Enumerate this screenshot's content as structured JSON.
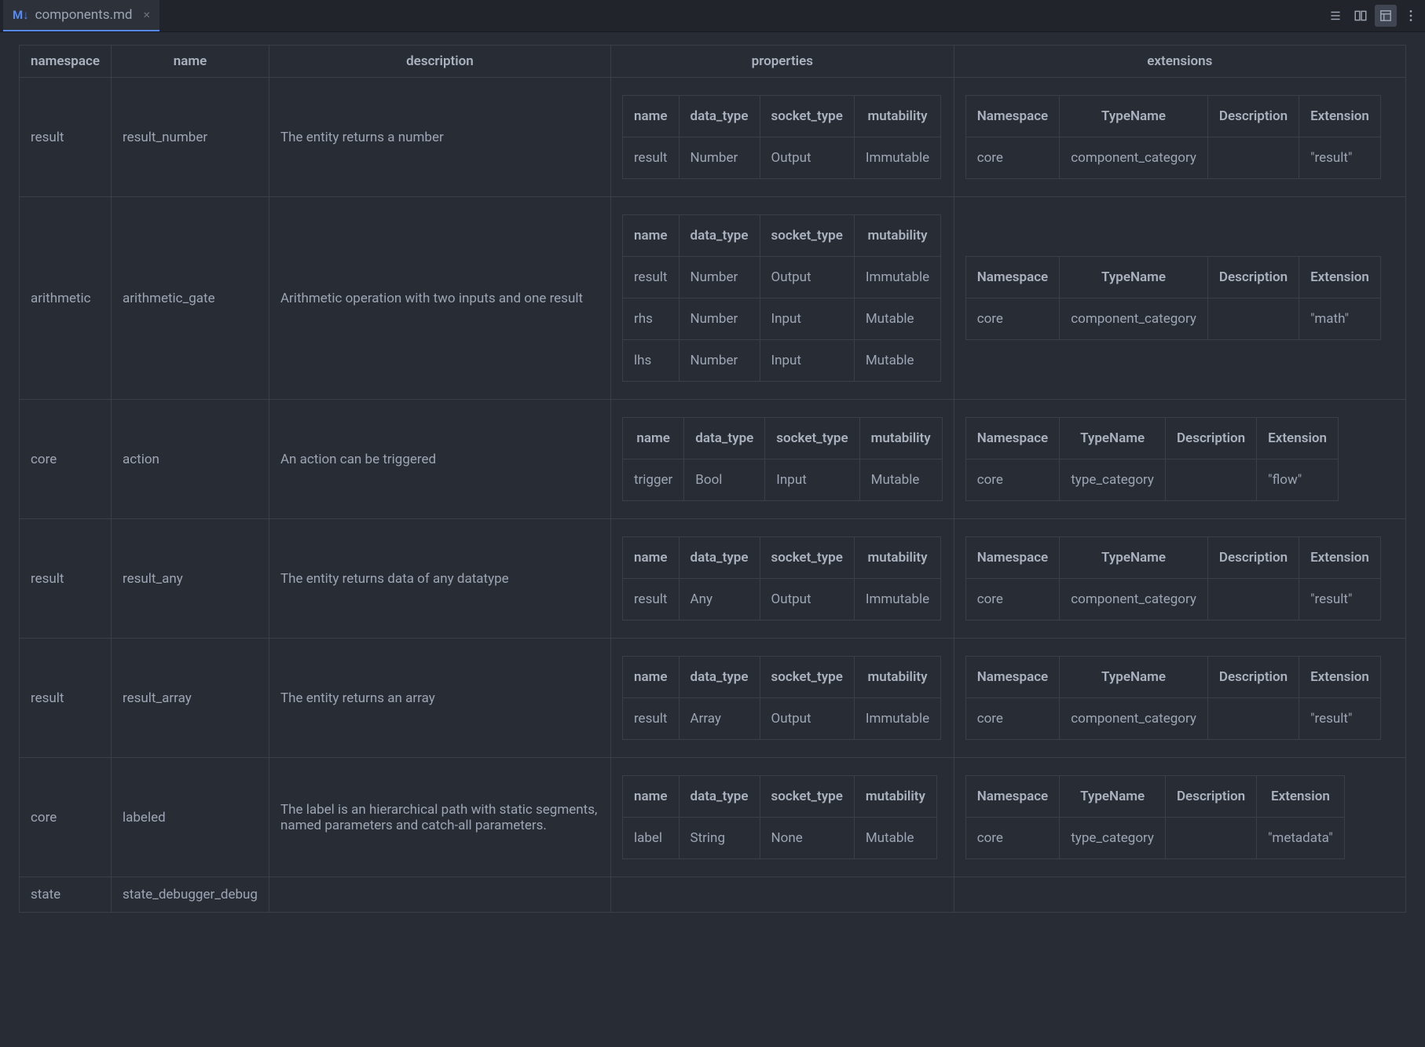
{
  "tab": {
    "icon_text": "M↓",
    "filename": "components.md"
  },
  "header_icons": [
    "outline-icon",
    "split-view-icon",
    "preview-icon",
    "more-icon"
  ],
  "columns": {
    "namespace": "namespace",
    "name": "name",
    "description": "description",
    "properties": "properties",
    "extensions": "extensions"
  },
  "prop_columns": {
    "name": "name",
    "data_type": "data_type",
    "socket_type": "socket_type",
    "mutability": "mutability"
  },
  "ext_columns": {
    "namespace": "Namespace",
    "typename": "TypeName",
    "description": "Description",
    "extension": "Extension"
  },
  "rows": [
    {
      "namespace": "result",
      "name": "result_number",
      "description": "The entity returns a number",
      "properties": [
        {
          "name": "result",
          "data_type": "Number",
          "socket_type": "Output",
          "mutability": "Immutable"
        }
      ],
      "extensions": [
        {
          "namespace": "core",
          "typename": "component_category",
          "description": "",
          "extension": "\"result\""
        }
      ]
    },
    {
      "namespace": "arithmetic",
      "name": "arithmetic_gate",
      "description": "Arithmetic operation with two inputs and one result",
      "properties": [
        {
          "name": "result",
          "data_type": "Number",
          "socket_type": "Output",
          "mutability": "Immutable"
        },
        {
          "name": "rhs",
          "data_type": "Number",
          "socket_type": "Input",
          "mutability": "Mutable"
        },
        {
          "name": "lhs",
          "data_type": "Number",
          "socket_type": "Input",
          "mutability": "Mutable"
        }
      ],
      "extensions": [
        {
          "namespace": "core",
          "typename": "component_category",
          "description": "",
          "extension": "\"math\""
        }
      ]
    },
    {
      "namespace": "core",
      "name": "action",
      "description": "An action can be triggered",
      "properties": [
        {
          "name": "trigger",
          "data_type": "Bool",
          "socket_type": "Input",
          "mutability": "Mutable"
        }
      ],
      "extensions": [
        {
          "namespace": "core",
          "typename": "type_category",
          "description": "",
          "extension": "\"flow\""
        }
      ]
    },
    {
      "namespace": "result",
      "name": "result_any",
      "description": "The entity returns data of any datatype",
      "properties": [
        {
          "name": "result",
          "data_type": "Any",
          "socket_type": "Output",
          "mutability": "Immutable"
        }
      ],
      "extensions": [
        {
          "namespace": "core",
          "typename": "component_category",
          "description": "",
          "extension": "\"result\""
        }
      ]
    },
    {
      "namespace": "result",
      "name": "result_array",
      "description": "The entity returns an array",
      "properties": [
        {
          "name": "result",
          "data_type": "Array",
          "socket_type": "Output",
          "mutability": "Immutable"
        }
      ],
      "extensions": [
        {
          "namespace": "core",
          "typename": "component_category",
          "description": "",
          "extension": "\"result\""
        }
      ]
    },
    {
      "namespace": "core",
      "name": "labeled",
      "description": "The label is an hierarchical path with static segments, named parameters and catch-all parameters.",
      "properties": [
        {
          "name": "label",
          "data_type": "String",
          "socket_type": "None",
          "mutability": "Mutable"
        }
      ],
      "extensions": [
        {
          "namespace": "core",
          "typename": "type_category",
          "description": "",
          "extension": "\"metadata\""
        }
      ]
    },
    {
      "namespace": "state",
      "name": "state_debugger_debug",
      "description": "",
      "properties": [],
      "extensions": []
    }
  ]
}
